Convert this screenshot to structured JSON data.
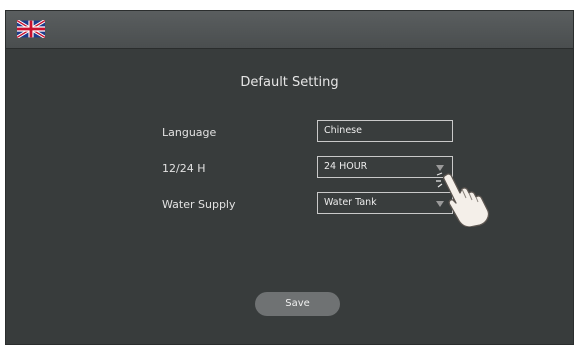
{
  "topbar": {
    "language_flag_icon": "uk-flag-icon"
  },
  "page": {
    "title": "Default Setting"
  },
  "settings": {
    "language": {
      "label": "Language",
      "value": "Chinese"
    },
    "time_format": {
      "label": "12/24 H",
      "value": "24 HOUR"
    },
    "water_supply": {
      "label": "Water Supply",
      "value": "Water Tank"
    }
  },
  "actions": {
    "save_label": "Save"
  },
  "colors": {
    "background": "#383c3c",
    "topbar": "#4e5253",
    "field_border": "#c9c9c9",
    "button": "#6f7273"
  }
}
